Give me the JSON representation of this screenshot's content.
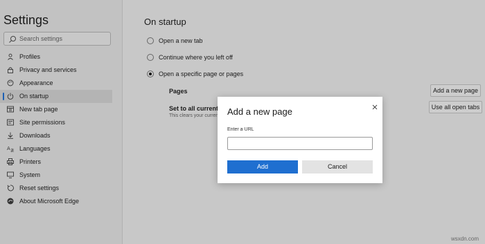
{
  "sidebar": {
    "title": "Settings",
    "search_placeholder": "Search settings",
    "items": [
      {
        "label": "Profiles",
        "icon": "profile-icon"
      },
      {
        "label": "Privacy and services",
        "icon": "lock-icon"
      },
      {
        "label": "Appearance",
        "icon": "appearance-icon"
      },
      {
        "label": "On startup",
        "icon": "power-icon",
        "active": true
      },
      {
        "label": "New tab page",
        "icon": "new-tab-icon"
      },
      {
        "label": "Site permissions",
        "icon": "site-permissions-icon"
      },
      {
        "label": "Downloads",
        "icon": "download-icon"
      },
      {
        "label": "Languages",
        "icon": "languages-icon"
      },
      {
        "label": "Printers",
        "icon": "printer-icon"
      },
      {
        "label": "System",
        "icon": "system-icon"
      },
      {
        "label": "Reset settings",
        "icon": "reset-icon"
      },
      {
        "label": "About Microsoft Edge",
        "icon": "edge-icon"
      }
    ]
  },
  "main": {
    "heading": "On startup",
    "options": [
      {
        "label": "Open a new tab",
        "selected": false
      },
      {
        "label": "Continue where you left off",
        "selected": false
      },
      {
        "label": "Open a specific page or pages",
        "selected": true
      }
    ],
    "pages_label": "Pages",
    "set_all_label": "Set to all currently",
    "set_all_sub": "This clears your current",
    "add_page_button": "Add a new page",
    "use_all_tabs_button": "Use all open tabs"
  },
  "dialog": {
    "title": "Add a new page",
    "url_label": "Enter a URL",
    "url_value": "",
    "add_button": "Add",
    "cancel_button": "Cancel"
  },
  "watermark": "wsxdn.com",
  "colors": {
    "accent": "#1f6fd0",
    "overlay": "#c4c4c4",
    "dialog_bg": "#ffffff"
  }
}
